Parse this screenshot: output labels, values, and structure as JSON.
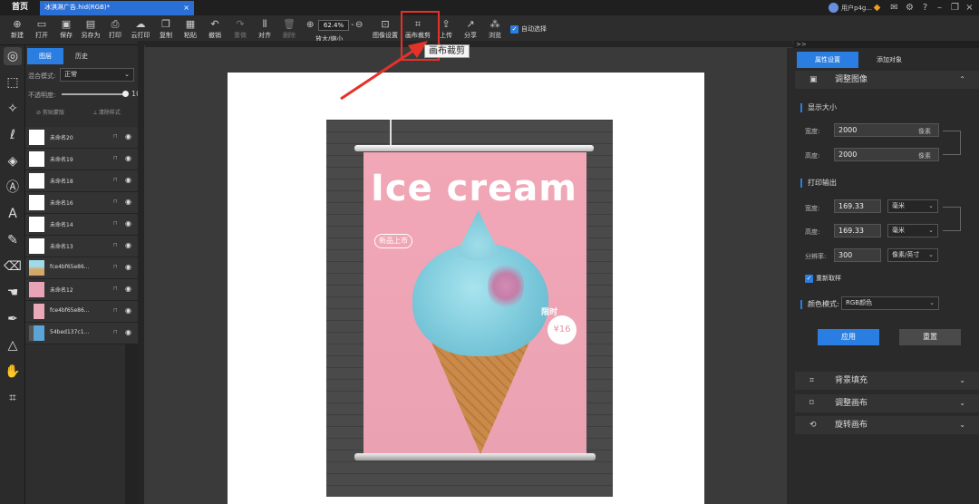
{
  "titlebar": {
    "home": "首页",
    "doc_tab": "冰淇淋广告.hid(RGB)*",
    "close": "×",
    "user": "用户p4g..."
  },
  "toolbar": {
    "items": [
      {
        "icon": "new-icon",
        "label": "新建"
      },
      {
        "icon": "open-icon",
        "label": "打开"
      },
      {
        "icon": "save-icon",
        "label": "保存"
      },
      {
        "icon": "save-as-icon",
        "label": "另存为"
      },
      {
        "icon": "print-icon",
        "label": "打印"
      },
      {
        "icon": "cloud-print-icon",
        "label": "云打印"
      },
      {
        "icon": "copy-icon",
        "label": "复制"
      },
      {
        "icon": "paste-icon",
        "label": "粘贴"
      },
      {
        "icon": "undo-icon",
        "label": "撤销"
      },
      {
        "icon": "redo-icon",
        "label": "重做"
      },
      {
        "icon": "align-icon",
        "label": "对齐"
      },
      {
        "icon": "delete-icon",
        "label": "删除"
      }
    ],
    "zoom_value": "62.4%",
    "zoom_label": "放大/缩小",
    "image_settings": "图像设置",
    "canvas_crop": "画布裁剪",
    "upload": "上传",
    "share": "分享",
    "browse": "浏览",
    "auto_select": "自动选择"
  },
  "tooltip": "画布裁剪",
  "layers_panel": {
    "tabs": [
      "图层",
      "历史"
    ],
    "blend_label": "混合模式:",
    "blend_value": "正常",
    "opacity_label": "不透明度:",
    "opacity_value": "100",
    "opacity_unit": "%",
    "opacity_level": 1.0,
    "btn_clip": "剪贴蒙版",
    "btn_clear": "清除样式",
    "layers": [
      {
        "name": "未命名20",
        "thumb": "white"
      },
      {
        "name": "未命名19",
        "thumb": "white"
      },
      {
        "name": "未命名18",
        "thumb": "white"
      },
      {
        "name": "未命名16",
        "thumb": "white"
      },
      {
        "name": "未命名14",
        "thumb": "white"
      },
      {
        "name": "未命名13",
        "thumb": "white"
      },
      {
        "name": "fce4bf65e86...",
        "thumb": "cone"
      },
      {
        "name": "未命名12",
        "thumb": "pink"
      },
      {
        "name": "fce4bf65e86...",
        "thumb": "pic"
      },
      {
        "name": "54bed137c1...",
        "thumb": "mix"
      }
    ]
  },
  "canvas": {
    "title": "Ice cream",
    "badge": "新品上市",
    "limited": "限时",
    "price": "¥16"
  },
  "right_panel": {
    "tabs": [
      "属性设置",
      "添加对象"
    ],
    "adjust_image": "调整图像",
    "display_size": "显示大小",
    "width_label": "宽度:",
    "height_label": "高度:",
    "display_width": "2000",
    "display_height": "2000",
    "px_unit": "像素",
    "print_output": "打印输出",
    "print_width": "169.33",
    "print_height": "169.33",
    "mm_unit": "毫米",
    "resolution_label": "分辨率:",
    "resolution": "300",
    "resolution_unit": "像素/英寸",
    "resample": "重新取样",
    "color_mode_label": "颜色模式:",
    "color_mode": "RGB颜色",
    "apply": "应用",
    "reset": "重置",
    "bg_fill": "背景填充",
    "adjust_canvas": "调整画布",
    "rotate_canvas": "旋转画布"
  },
  "colors": {
    "accent": "#2a7de1",
    "highlight": "#e53228",
    "poster_pink": "#f2a7b7"
  }
}
